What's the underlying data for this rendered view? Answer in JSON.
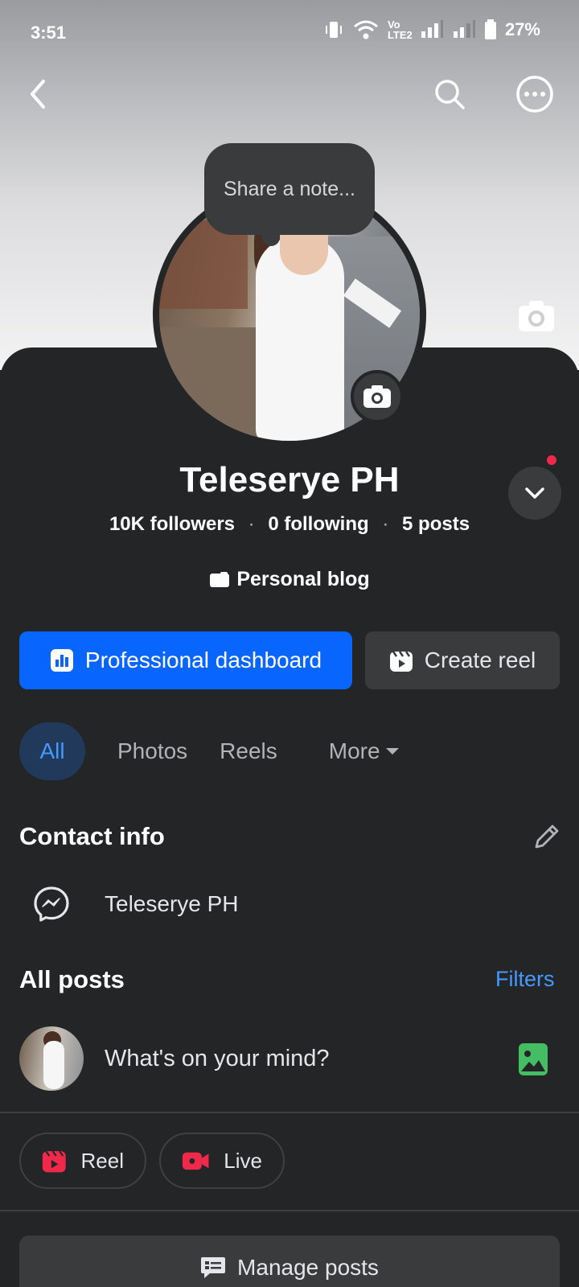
{
  "status_bar": {
    "time": "3:51",
    "network_label": "Vo LTE2",
    "battery": "27%"
  },
  "header": {
    "back_icon": "chevron-left-icon",
    "search_icon": "search-icon",
    "more_icon": "more-horizontal-icon"
  },
  "note": {
    "placeholder": "Share a note..."
  },
  "profile": {
    "name": "Teleserye PH",
    "followers": "10K followers",
    "following": "0 following",
    "posts": "5 posts",
    "separator": "·",
    "category": "Personal blog"
  },
  "actions": {
    "professional_dashboard": "Professional dashboard",
    "create_reel": "Create reel"
  },
  "tabs": [
    {
      "label": "All",
      "active": true
    },
    {
      "label": "Photos",
      "active": false
    },
    {
      "label": "Reels",
      "active": false
    },
    {
      "label": "More",
      "active": false
    }
  ],
  "contact": {
    "title": "Contact info",
    "messenger_name": "Teleserye PH"
  },
  "posts": {
    "title": "All posts",
    "filters_label": "Filters",
    "composer_placeholder": "What's on your mind?",
    "reel_chip": "Reel",
    "live_chip": "Live",
    "manage_label": "Manage posts"
  },
  "colors": {
    "accent": "#0866ff",
    "link": "#4599ff",
    "background": "#242527",
    "notification_dot": "#f02849"
  }
}
